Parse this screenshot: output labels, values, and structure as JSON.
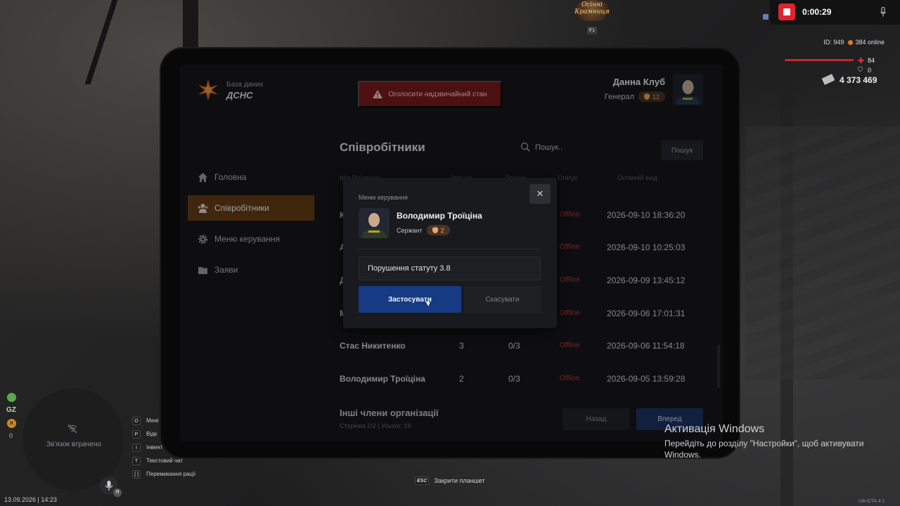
{
  "event_logo": {
    "text": "Осінні Крамниця",
    "key": "F1"
  },
  "recording": {
    "time": "0:00:29"
  },
  "hud": {
    "id_label": "ID: 949",
    "online": "384 online",
    "health": "84",
    "armor": "0",
    "money": "4 373 469",
    "colors": {
      "health": "#c32a2a",
      "online_dot": "#e07a2c"
    }
  },
  "tablet": {
    "brand": {
      "subtitle": "База даних",
      "title": "ДСНС"
    },
    "emergency_button": "Оголосити надзвичайний стан",
    "user": {
      "name": "Данна Клуб",
      "rank": "Генерал",
      "level": "12"
    },
    "nav": [
      {
        "label": "Головна",
        "icon": "home-icon"
      },
      {
        "label": "Співробітники",
        "icon": "users-icon",
        "active": true
      },
      {
        "label": "Меню керування",
        "icon": "gear-icon"
      },
      {
        "label": "Заяви",
        "icon": "folder-icon"
      }
    ],
    "page_title": "Співробітники",
    "search": {
      "placeholder": "Пошук..",
      "button": "Пошук"
    },
    "table": {
      "headers": [
        "Ім'я Прізвище",
        "Звання",
        "Догани",
        "Статус",
        "Останній вхід"
      ],
      "rows": [
        {
          "name": "К",
          "rank": "",
          "warnings": "",
          "status": "Offline",
          "last_login": "2026-09-10 18:36:20"
        },
        {
          "name": "А",
          "rank": "",
          "warnings": "",
          "status": "Offline",
          "last_login": "2026-09-10 10:25:03"
        },
        {
          "name": "Д",
          "rank": "",
          "warnings": "",
          "status": "Offline",
          "last_login": "2026-09-09 13:45:12"
        },
        {
          "name": "М",
          "rank": "",
          "warnings": "",
          "status": "Offline",
          "last_login": "2026-09-06 17:01:31"
        },
        {
          "name": "Стас Никитенко",
          "rank": "3",
          "warnings": "0/3",
          "status": "Offline",
          "last_login": "2026-09-06 11:54:18"
        },
        {
          "name": "Володимир Троїціна",
          "rank": "2",
          "warnings": "0/3",
          "status": "Offline",
          "last_login": "2026-09-05 13:59:28"
        }
      ]
    },
    "other_members": "Інші члени організації",
    "pager": {
      "info": "Сторінка 2/2 | Усього: 19",
      "back": "Назад",
      "next": "Вперед"
    }
  },
  "modal": {
    "title": "Меню керування",
    "close": "✕",
    "employee": {
      "name": "Володимир Троїціна",
      "rank": "Сержант",
      "level": "2"
    },
    "reason_value": "Порушення статуту 3.8",
    "apply": "Застосувати",
    "cancel": "Скасувати"
  },
  "bottom_hud": {
    "gz": "GZ",
    "counter": "0",
    "minimap_lost": "Зв'язок втрачено",
    "mic_key": "Я",
    "datetime": "13.09.2026 | 14:23",
    "keys": [
      {
        "key": "O",
        "label": "Мені"
      },
      {
        "key": "P",
        "label": "Відк"
      },
      {
        "key": "I",
        "label": "Інвент"
      },
      {
        "key": "T",
        "label": "Текстовий чат"
      },
      {
        "key": "[ ]",
        "label": "Перемикання рації"
      }
    ],
    "esc": {
      "key": "ESC",
      "label": "Закрити планшет"
    }
  },
  "windows_activation": {
    "title": "Активація Windows",
    "text": "Перейдіть до розділу \"Настройки\", щоб активувати Windows."
  },
  "version": "UA-GTA 4.1"
}
